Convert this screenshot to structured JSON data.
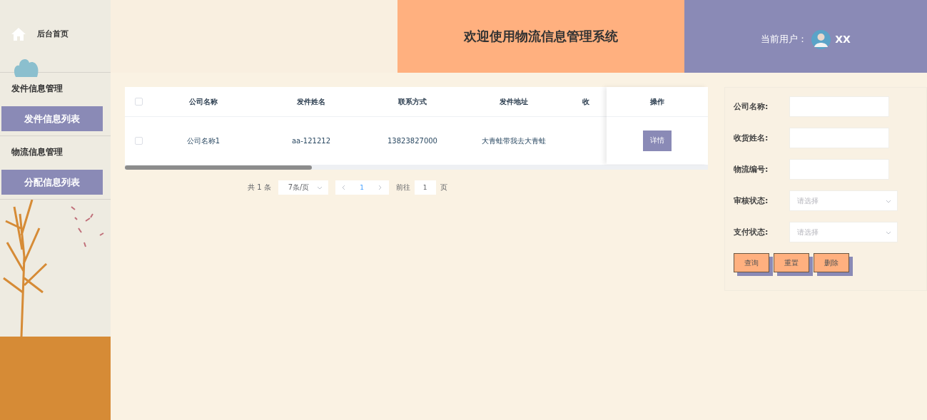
{
  "sidebar": {
    "home": {
      "label": "后台首页"
    },
    "groups": [
      {
        "title": "发件信息管理",
        "items": [
          {
            "label": "发件信息列表",
            "selected": true
          }
        ]
      },
      {
        "title": "物流信息管理",
        "items": [
          {
            "label": "分配信息列表",
            "selected": true
          }
        ]
      }
    ]
  },
  "header": {
    "title": "欢迎使用物流信息管理系统",
    "user_label": "当前用户：",
    "user_name": "XX"
  },
  "table": {
    "header_checked": false,
    "columns": [
      "公司名称",
      "发件姓名",
      "联系方式",
      "发件地址",
      "收"
    ],
    "action_column": "操作",
    "rows": [
      {
        "checked": false,
        "cells": [
          "公司名称1",
          "aa-121212",
          "13823827000",
          "大青蛙带我去大青蛙",
          ""
        ],
        "action": "详情"
      }
    ],
    "pagination": {
      "total": "共 1 条",
      "page_size": "7条/页",
      "pages": [
        {
          "label": "1",
          "selected": true
        }
      ],
      "goto_label": "前往",
      "goto_value": "1",
      "goto_suffix": "页"
    }
  },
  "search": {
    "fields": [
      {
        "kind": "input",
        "label": "公司名称:"
      },
      {
        "kind": "input",
        "label": "收货姓名:"
      },
      {
        "kind": "input",
        "label": "物流编号:"
      },
      {
        "kind": "select",
        "label": "审核状态:",
        "placeholder": "请选择"
      },
      {
        "kind": "select",
        "label": "支付状态:",
        "placeholder": "请选择"
      }
    ],
    "buttons": [
      "查询",
      "重置",
      "删除"
    ]
  }
}
